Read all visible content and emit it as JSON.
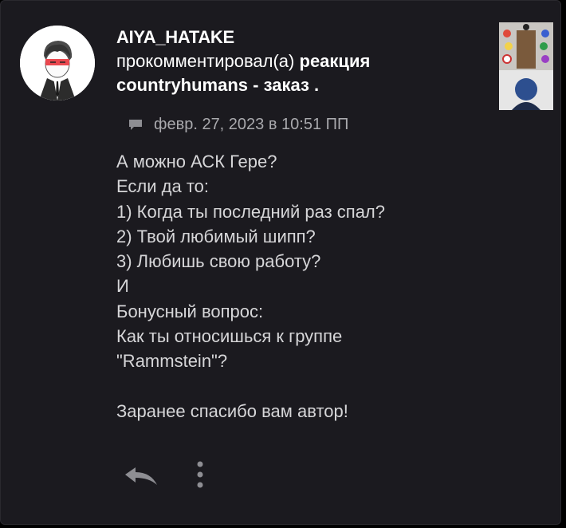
{
  "comment": {
    "username": "AIYA_HATAKE",
    "action": "прокомментировал(а)",
    "target_prefix": "реакция",
    "target_rest": "countryhumans - заказ .",
    "timestamp": "февр. 27, 2023 в 10:51 ПП",
    "body": "А можно АСК Гере?\nЕсли да то:\n1) Когда ты последний раз спал?\n2) Твой любимый шипп?\n3) Любишь свою работу?\nИ\nБонусный вопрос:\nКак ты относишься к группе\n\"Rammstein\"?\n\nЗаранее спасибо вам автор!"
  },
  "icons": {
    "meta": "chat-bubble-icon",
    "reply": "reply-icon",
    "more": "more-vertical-icon"
  },
  "colors": {
    "background": "#000000",
    "card": "#1b1a1f",
    "text_primary": "#ffffff",
    "text_body": "#d6d6d8",
    "text_muted": "#a9a9ad",
    "icon": "#8e8e93"
  }
}
